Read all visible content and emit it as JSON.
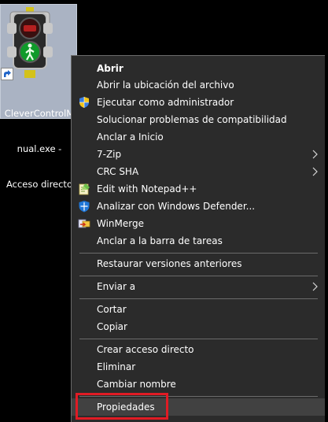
{
  "desktop_icon": {
    "name": "shortcut-clevercontrolmanual",
    "label_lines": [
      "CleverControlM",
      "nual.exe -",
      "Acceso directo"
    ]
  },
  "context_menu": {
    "items": [
      {
        "label": "Abrir",
        "bold": true
      },
      {
        "label": "Abrir la ubicación del archivo"
      },
      {
        "label": "Ejecutar como administrador",
        "icon": "uac-shield-icon"
      },
      {
        "label": "Solucionar problemas de compatibilidad"
      },
      {
        "label": "Anclar a Inicio"
      },
      {
        "label": "7-Zip",
        "submenu": true
      },
      {
        "label": "CRC SHA",
        "submenu": true
      },
      {
        "label": "Edit with Notepad++",
        "icon": "notepadplusplus-icon"
      },
      {
        "label": "Analizar con Windows Defender...",
        "icon": "windows-defender-icon"
      },
      {
        "label": "WinMerge",
        "icon": "winmerge-icon"
      },
      {
        "label": "Anclar a la barra de tareas"
      },
      {
        "label": "Restaurar versiones anteriores"
      },
      {
        "label": "Enviar a",
        "submenu": true
      },
      {
        "label": "Cortar"
      },
      {
        "label": "Copiar"
      },
      {
        "label": "Crear acceso directo"
      },
      {
        "label": "Eliminar"
      },
      {
        "label": "Cambiar nombre"
      },
      {
        "label": "Propiedades",
        "highlighted": true
      }
    ]
  },
  "colors": {
    "menu_background": "#2b2b2b",
    "menu_hover": "#414141",
    "menu_border": "#6b6b6b",
    "highlight_box": "#e01b24",
    "desktop_background": "#000000",
    "selected_tile": "#aab3c3"
  }
}
